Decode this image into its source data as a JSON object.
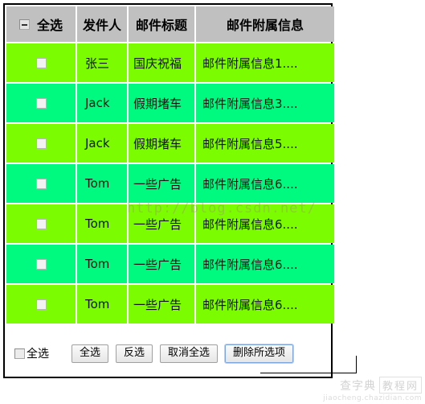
{
  "table": {
    "headers": {
      "select_all": "全选",
      "sender": "发件人",
      "subject": "邮件标题",
      "attachment_info": "邮件附属信息"
    },
    "header_checkbox_state": "indeterminate",
    "rows": [
      {
        "sender": "张三",
        "subject": "国庆祝福",
        "info": "邮件附属信息1....",
        "checked": false
      },
      {
        "sender": "Jack",
        "subject": "假期堵车",
        "info": "邮件附属信息3....",
        "checked": false
      },
      {
        "sender": "Jack",
        "subject": "假期堵车",
        "info": "邮件附属信息5....",
        "checked": false
      },
      {
        "sender": "Tom",
        "subject": "一些广告",
        "info": "邮件附属信息6....",
        "checked": false
      },
      {
        "sender": "Tom",
        "subject": "一些广告",
        "info": "邮件附属信息6....",
        "checked": false
      },
      {
        "sender": "Tom",
        "subject": "一些广告",
        "info": "邮件附属信息6....",
        "checked": false
      },
      {
        "sender": "Tom",
        "subject": "一些广告",
        "info": "邮件附属信息6....",
        "checked": false
      }
    ]
  },
  "footer": {
    "check_label": "全选",
    "check_checked": false,
    "buttons": [
      {
        "label": "全选",
        "focused": false
      },
      {
        "label": "反选",
        "focused": false
      },
      {
        "label": "取消全选",
        "focused": false
      },
      {
        "label": "删除所选项",
        "focused": true
      }
    ]
  },
  "watermarks": {
    "center_url": "http://blog.csdn.net/",
    "brand_part_a": "查字典",
    "brand_part_b": "教程网",
    "brand_url": "jiaocheng.chazidian.com"
  },
  "colors": {
    "header_bg": "#c0c0c0",
    "row_odd_bg": "#7cfc00",
    "row_even_bg": "#00fa80",
    "panel_border": "#000000",
    "focus_ring": "#7da5dd"
  }
}
